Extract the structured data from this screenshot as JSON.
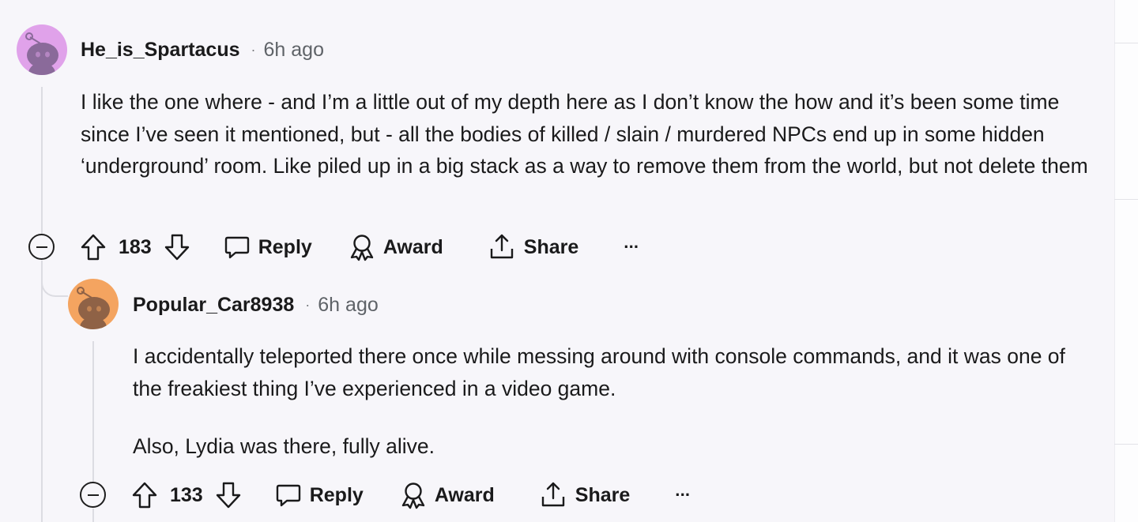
{
  "comments": [
    {
      "username": "He_is_Spartacus",
      "separator": "·",
      "time": "6h ago",
      "paragraphs": [
        "I like the one where - and I’m a little out of my depth here as I don’t know the how and it’s been some time since I’ve seen it mentioned, but - all the bodies of killed / slain / murdered NPCs end up in some hidden ‘underground’ room. Like piled up in a big stack as a way to remove them from the world, but not delete them"
      ],
      "score": "183",
      "reply_label": "Reply",
      "award_label": "Award",
      "share_label": "Share",
      "more_label": "···",
      "avatar_color": "#e0a2ea"
    },
    {
      "username": "Popular_Car8938",
      "separator": "·",
      "time": "6h ago",
      "paragraphs": [
        "I accidentally teleported there once while messing around with console commands, and it was one of the freakiest thing I’ve experienced in a video game.",
        "Also, Lydia was there, fully alive."
      ],
      "score": "133",
      "reply_label": "Reply",
      "award_label": "Award",
      "share_label": "Share",
      "more_label": "···",
      "avatar_color": "#f4a460"
    }
  ],
  "colors": {
    "background": "#f7f6fa",
    "text": "#1a1a1b",
    "meta": "#5f6368",
    "thread_line": "#dcdce2"
  }
}
